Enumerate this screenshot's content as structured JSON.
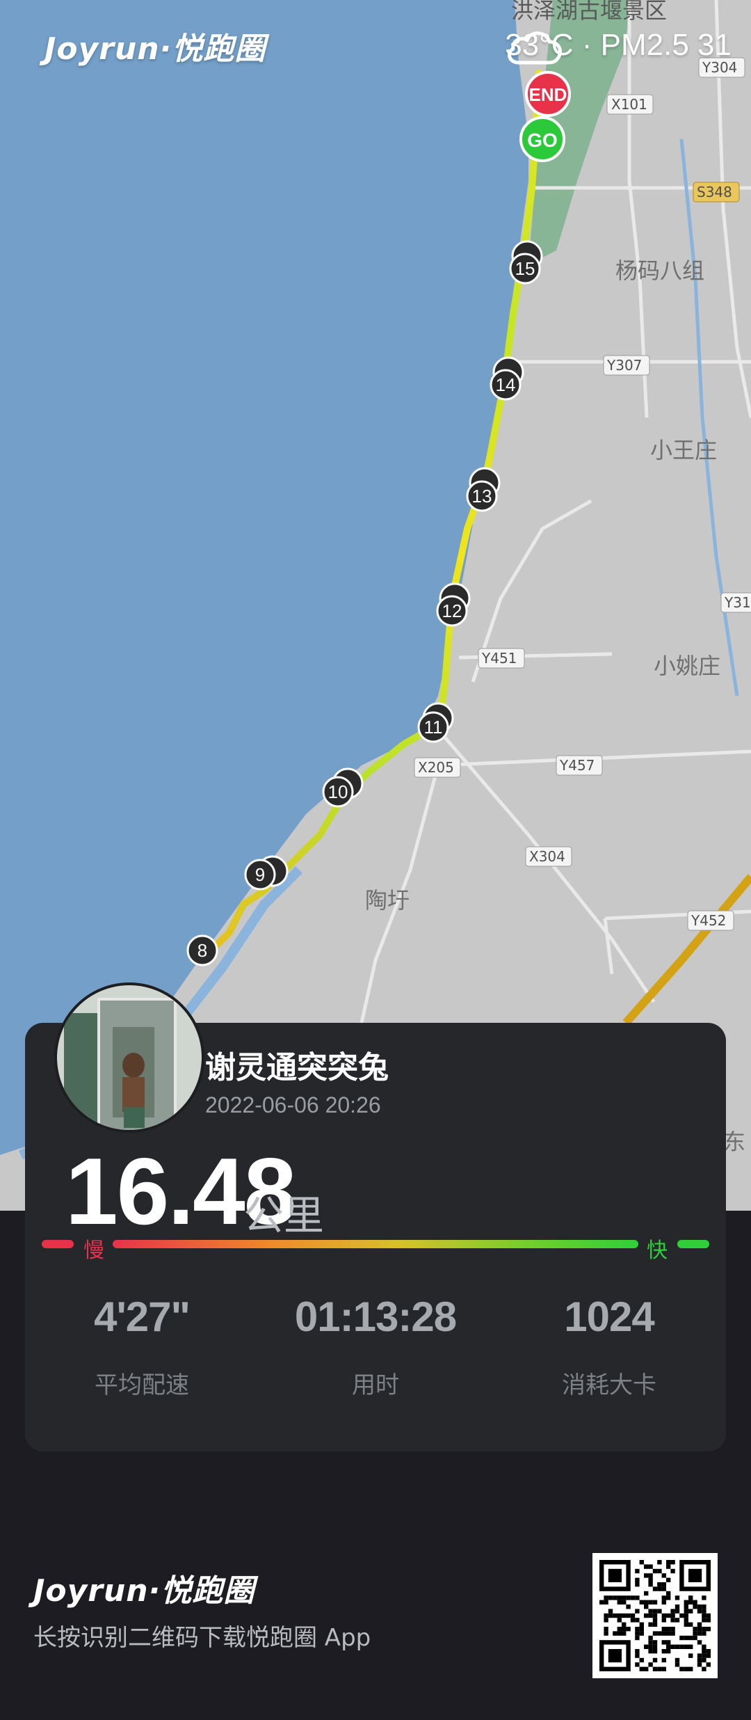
{
  "brand": {
    "name": "Joyrun·悦跑圈"
  },
  "weather": {
    "icon": "cloud-icon",
    "text": "33°C · PM2.5 31"
  },
  "map": {
    "place_labels": [
      "洪泽湖古堰景区",
      "杨码八组",
      "小王庄",
      "小姚庄",
      "陶圩",
      "东"
    ],
    "road_labels": [
      "Y304",
      "X101",
      "S348",
      "Y307",
      "Y31",
      "Y451",
      "X205",
      "Y457",
      "X304",
      "Y452"
    ],
    "markers": {
      "start": "GO",
      "end": "END"
    },
    "km_markers": [
      "8",
      "9",
      "10",
      "11",
      "12",
      "13",
      "14",
      "15"
    ]
  },
  "user": {
    "name": "谢灵通突突兔",
    "datetime": "2022-06-06 20:26"
  },
  "summary": {
    "distance": "16.48",
    "unit": "公里"
  },
  "pace_legend": {
    "slow": "慢",
    "fast": "快"
  },
  "stats": [
    {
      "value": "4'27\"",
      "label": "平均配速"
    },
    {
      "value": "01:13:28",
      "label": "用时"
    },
    {
      "value": "1024",
      "label": "消耗大卡"
    }
  ],
  "footer": {
    "brand": "Joyrun·悦跑圈",
    "tagline": "长按识别二维码下载悦跑圈 App"
  },
  "colors": {
    "lake": "#739fc8",
    "land": "#c8c8c8",
    "slow": "#e8324a",
    "fast": "#2fcf3a",
    "card": "#25272a"
  }
}
